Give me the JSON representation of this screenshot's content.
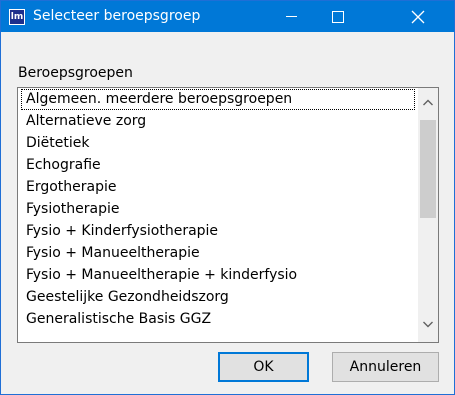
{
  "window": {
    "title": "Selecteer beroepsgroep",
    "icon_text": "lm"
  },
  "titlebar": {
    "minimize_icon": "minimize-icon",
    "maximize_icon": "maximize-icon",
    "close_icon": "close-icon"
  },
  "list": {
    "label": "Beroepsgroepen",
    "items": [
      "Algemeen. meerdere beroepsgroepen",
      "Alternatieve zorg",
      "Diëtetiek",
      "Echografie",
      "Ergotherapie",
      "Fysiotherapie",
      "Fysio + Kinderfysiotherapie",
      "Fysio + Manueeltherapie",
      "Fysio + Manueeltherapie + kinderfysio",
      "Geestelijke Gezondheidszorg",
      "Generalistische Basis GGZ"
    ],
    "focused_index": 0
  },
  "buttons": {
    "ok": "OK",
    "cancel": "Annuleren"
  },
  "colors": {
    "titlebar": "#0078d7",
    "default_button_border": "#0078d7"
  }
}
